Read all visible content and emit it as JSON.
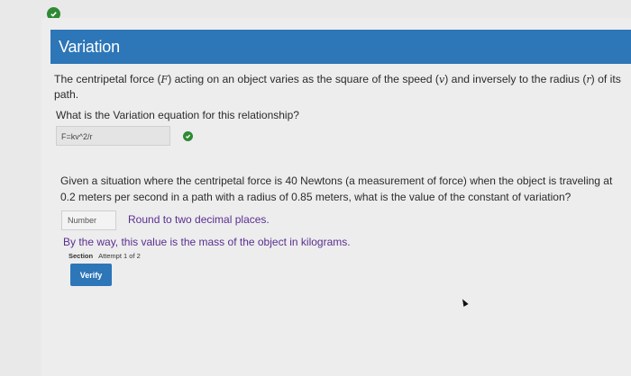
{
  "header": {
    "title": "Variation"
  },
  "question1": {
    "text_a": "The centripetal force (",
    "var_f": "F",
    "text_b": ") acting on an object varies as the square of the speed (",
    "var_v": "v",
    "text_c": ") and inversely to the radius (",
    "var_r": "r",
    "text_d": ") of its path.",
    "prompt": "What is the Variation equation for this relationship?",
    "answer_value": "F=kv^2/r"
  },
  "question2": {
    "text": "Given a situation where the centripetal force is 40 Newtons (a measurement of force) when the object is traveling at 0.2 meters per second in a path with a radius of 0.85 meters, what is the value of the constant of variation?",
    "input_placeholder": "Number",
    "round_hint": "Round to two decimal places.",
    "note": "By the way, this value is the mass of the object in kilograms."
  },
  "section": {
    "label": "Section",
    "attempt": "Attempt 1 of 2"
  },
  "verify_button": {
    "label": "Verify"
  },
  "icons": {
    "top": "check-circle-icon",
    "answer": "check-circle-icon"
  },
  "colors": {
    "accent": "#2d76b8",
    "success": "#2f8a34",
    "hint": "#5a2f8e"
  }
}
